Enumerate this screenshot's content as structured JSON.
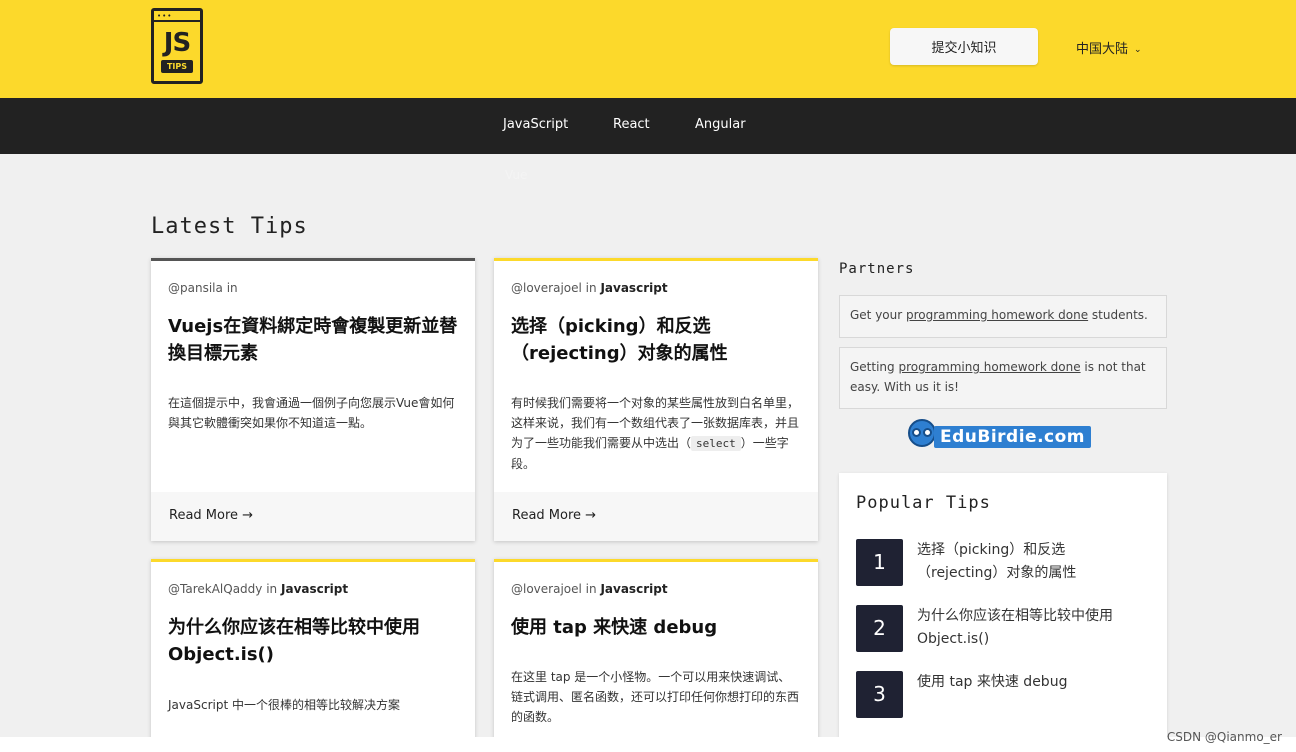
{
  "header": {
    "logo_text": "JS",
    "logo_badge": "TIPS",
    "logo_dots": "•••",
    "submit_label": "提交小知识",
    "region_label": "中国大陆",
    "chevron": "⌄"
  },
  "nav": {
    "items": [
      {
        "label": "JavaScript"
      },
      {
        "label": "React"
      },
      {
        "label": "Angular"
      }
    ],
    "ghost_label": "Vue"
  },
  "main": {
    "section_title": "Latest Tips",
    "cards": [
      {
        "author": "@pansila",
        "in_word": "in",
        "category": "",
        "title": "Vuejs在資料綁定時會複製更新並替換目標元素",
        "desc": "在這個提示中，我會通過一個例子向您展示Vue會如何與其它軟體衝突如果你不知道這一點。",
        "read_more": "Read More →"
      },
      {
        "author": "@loverajoel",
        "in_word": "in",
        "category": "Javascript",
        "title": "选择（picking）和反选（rejecting）对象的属性",
        "desc_before": "有时候我们需要将一个对象的某些属性放到白名单里，这样来说，我们有一个数组代表了一张数据库表，并且为了一些功能我们需要从中选出（",
        "desc_code": "select",
        "desc_after": "）一些字段。",
        "read_more": "Read More →"
      },
      {
        "author": "@TarekAlQaddy",
        "in_word": "in",
        "category": "Javascript",
        "title": "为什么你应该在相等比较中使用 Object.is()",
        "desc": "JavaScript 中一个很棒的相等比较解决方案"
      },
      {
        "author": "@loverajoel",
        "in_word": "in",
        "category": "Javascript",
        "title": "使用 tap 来快速 debug",
        "desc": "在这里 tap 是一个小怪物。一个可以用来快速调试、链式调用、匿名函数，还可以打印任何你想打印的东西的函数。"
      }
    ]
  },
  "sidebar": {
    "partners_title": "Partners",
    "partner1_before": "Get your ",
    "partner1_link": "programming homework done",
    "partner1_after": " students.",
    "partner2_before": "Getting ",
    "partner2_link": "programming homework done",
    "partner2_after": " is not that easy. With us it is!",
    "edubirdie_text": "EduBirdie.com",
    "popular_title": "Popular Tips",
    "popular": [
      {
        "num": "1",
        "text": "选择（picking）和反选（rejecting）对象的属性"
      },
      {
        "num": "2",
        "text": "为什么你应该在相等比较中使用 Object.is()"
      },
      {
        "num": "3",
        "text": "使用 tap 来快速 debug"
      }
    ]
  },
  "watermark": "CSDN @Qianmo_er",
  "colors": {
    "brand_yellow": "#fcd92b",
    "nav_dark": "#222222",
    "number_badge": "#1f2233",
    "edubirdie_blue": "#2e7fd1"
  }
}
